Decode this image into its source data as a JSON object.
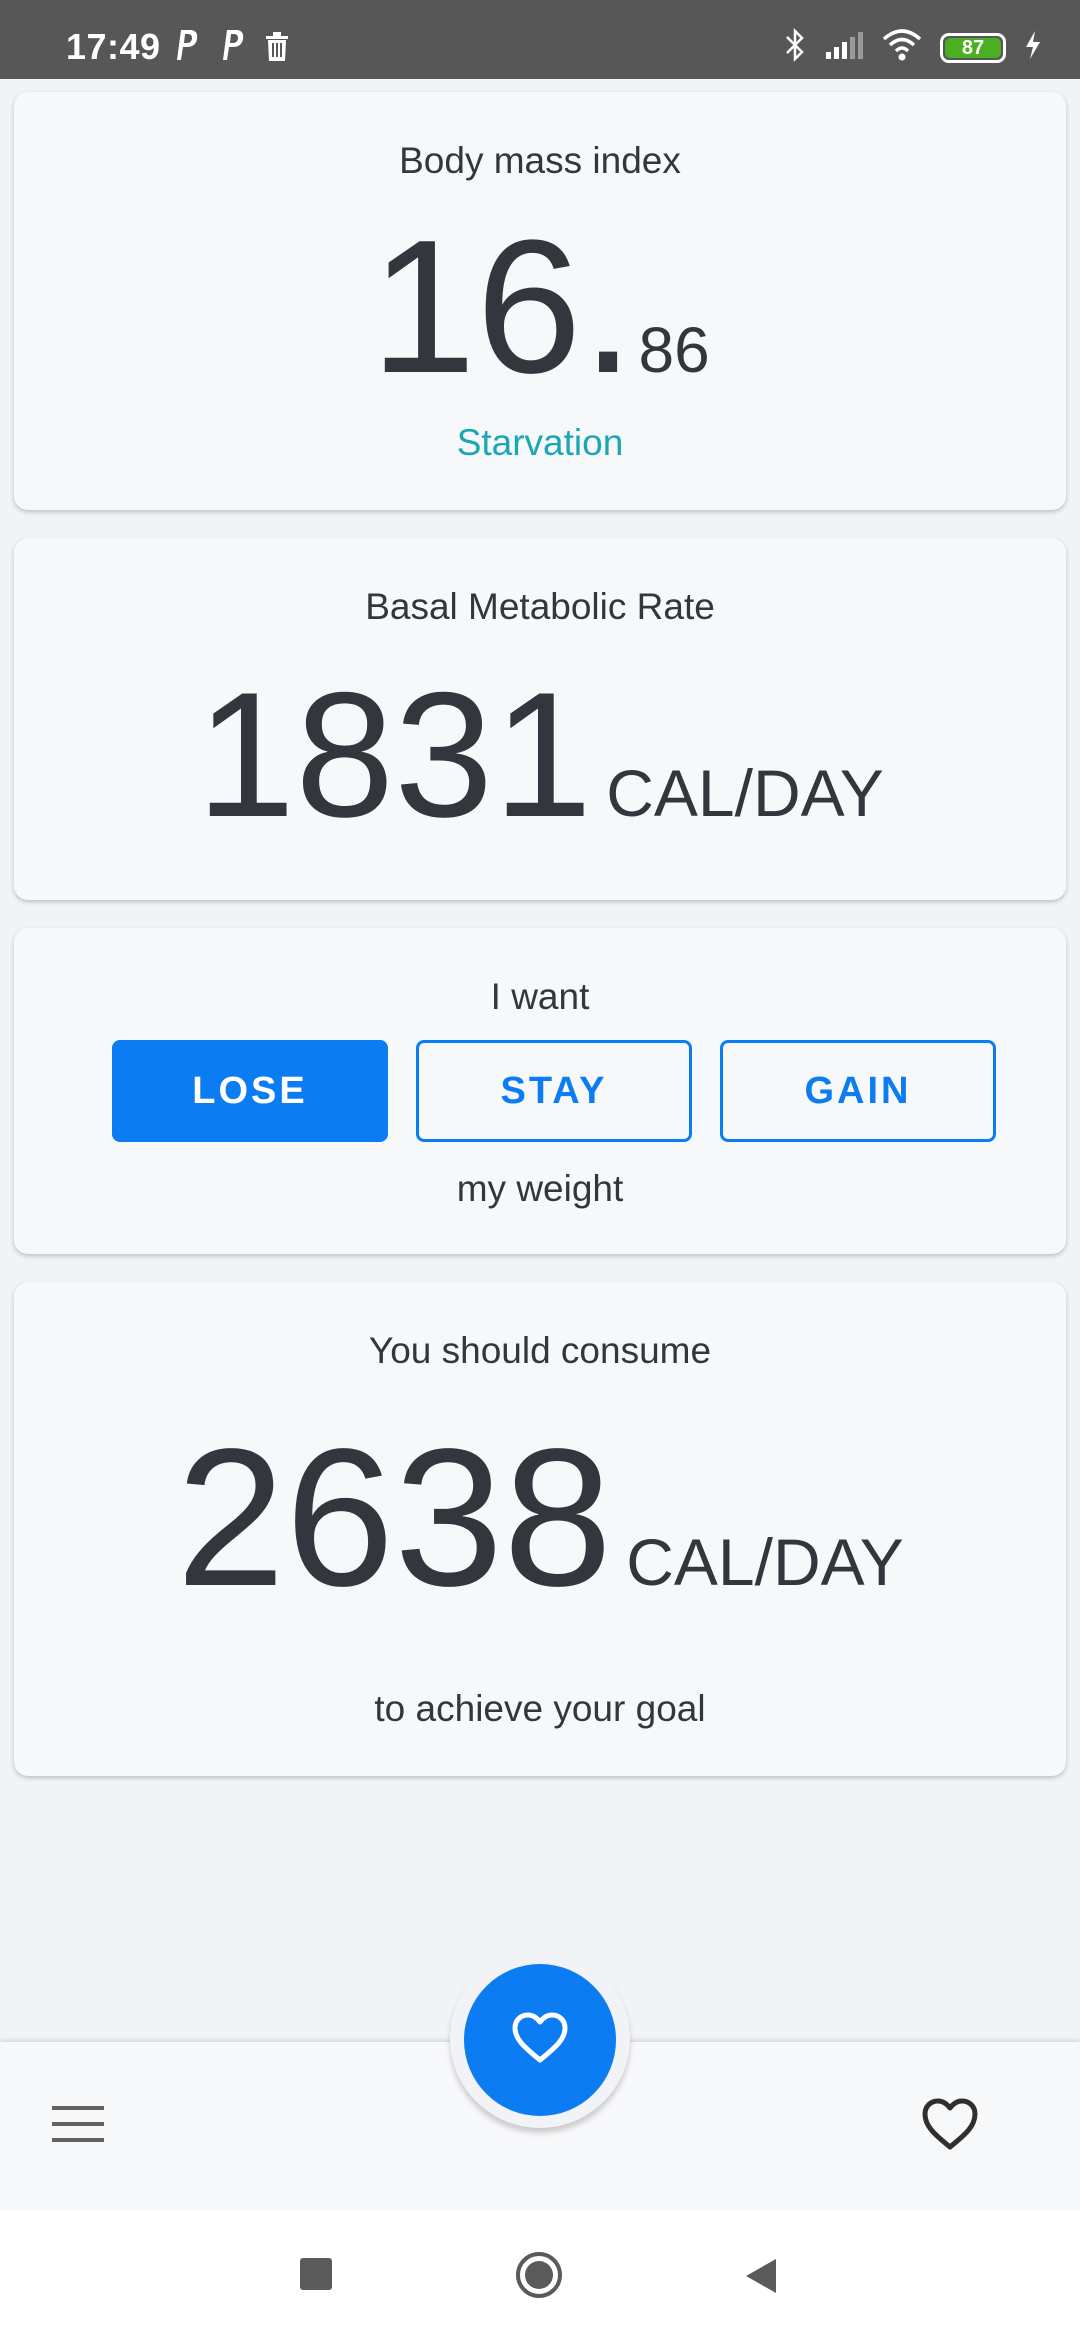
{
  "status_bar": {
    "time": "17:49",
    "battery_level": "87",
    "left_icons": [
      "parking-icon",
      "parking-icon",
      "delete-icon"
    ],
    "right_icons": [
      "bluetooth-icon",
      "signal-icon",
      "wifi-icon",
      "battery-icon",
      "charging-icon"
    ]
  },
  "bmi": {
    "title": "Body mass index",
    "value_int": "16",
    "value_dot": ".",
    "value_dec": "86",
    "status": "Starvation",
    "status_color": "#1ba6b3"
  },
  "bmr": {
    "title": "Basal Metabolic Rate",
    "value": "1831",
    "unit": "CAL/DAY"
  },
  "goal": {
    "title": "I want",
    "options": [
      {
        "label": "LOSE",
        "selected": true
      },
      {
        "label": "STAY",
        "selected": false
      },
      {
        "label": "GAIN",
        "selected": false
      }
    ],
    "footer": "my weight"
  },
  "consume": {
    "title": "You should consume",
    "value": "2638",
    "unit": "CAL/DAY",
    "footer": "to achieve your goal"
  },
  "bottom_bar": {
    "menu_icon": "menu-icon",
    "fab_icon": "heart-icon",
    "favorite_icon": "heart-outline-icon"
  },
  "colors": {
    "accent": "#0c7cf2",
    "status_bar": "#575757",
    "background": "#f1f3f6",
    "card": "#f7f8fa",
    "text": "#33373d"
  }
}
